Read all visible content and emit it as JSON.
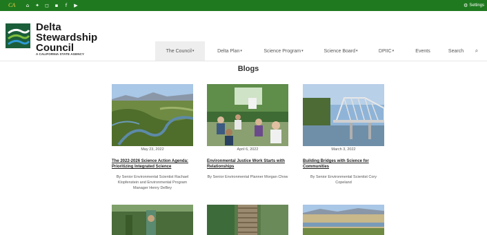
{
  "topbar": {
    "ca_logo": "CA",
    "social_icons": [
      "home-icon",
      "twitter-icon",
      "instagram-icon",
      "linkedin-icon",
      "facebook-icon",
      "youtube-icon"
    ],
    "settings_label": "Settings"
  },
  "brand": {
    "line1": "Delta",
    "line2": "Stewardship",
    "line3": "Council",
    "tagline": "A CALIFORNIA STATE AGENCY"
  },
  "nav": {
    "items": [
      {
        "label": "The Council",
        "dropdown": true
      },
      {
        "label": "Delta Plan",
        "dropdown": true
      },
      {
        "label": "Science Program",
        "dropdown": true
      },
      {
        "label": "Science Board",
        "dropdown": true
      },
      {
        "label": "DPIIC",
        "dropdown": true
      },
      {
        "label": "Events",
        "dropdown": false
      },
      {
        "label": "Search",
        "dropdown": false
      }
    ]
  },
  "page": {
    "title": "Blogs"
  },
  "posts": [
    {
      "date": "May 23, 2022",
      "title": "The 2022-2026 Science Action Agenda: Prioritizing Integrated Science",
      "author": "By Senior Environmental Scientist Rachael Klopfenstein and Environmental Program Manager Henry DeBey"
    },
    {
      "date": "April 6, 2022",
      "title": "Environmental Justice Work Starts with Relationships",
      "author": "By Senior Environmental Planner Morgan Chow"
    },
    {
      "date": "March 3, 2022",
      "title": "Building Bridges with Science for Communities",
      "author": "By Senior Environmental Scientist Cory Copeland"
    }
  ],
  "colors": {
    "topbar": "#1f7a1f",
    "accent": "#2a7d2e"
  }
}
